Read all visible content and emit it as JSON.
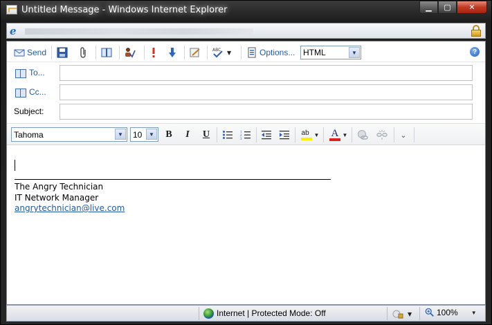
{
  "window": {
    "title": "Untitled Message - Windows Internet Explorer",
    "buttons": {
      "minimize": "▁",
      "maximize": "▢",
      "close": "✕"
    }
  },
  "toolbar": {
    "send_label": "Send",
    "options_label": "Options...",
    "format_select": "HTML",
    "icons": [
      "send-icon",
      "save-icon",
      "attach-icon",
      "address-book-icon",
      "check-names-icon",
      "high-importance-icon",
      "low-importance-icon",
      "signature-icon",
      "spell-check-icon",
      "options-icon",
      "help-icon"
    ]
  },
  "fields": {
    "to_label": "To...",
    "cc_label": "Cc...",
    "subject_label": "Subject:",
    "to_value": "",
    "cc_value": "",
    "subject_value": ""
  },
  "format": {
    "font": "Tahoma",
    "size": "10",
    "bold": "B",
    "italic": "I",
    "underline": "U",
    "font_color_glyph": "A",
    "highlight_glyph": "ab"
  },
  "signature": {
    "name": "The Angry Technician",
    "role": "IT Network Manager",
    "email": "angrytechnician@live.com"
  },
  "statusbar": {
    "zone": "Internet | Protected Mode: Off",
    "zoom": "100%"
  },
  "colors": {
    "link": "#1d5aa8",
    "font_color_bar": "#e0201b",
    "highlight_bar": "#f7f000"
  }
}
